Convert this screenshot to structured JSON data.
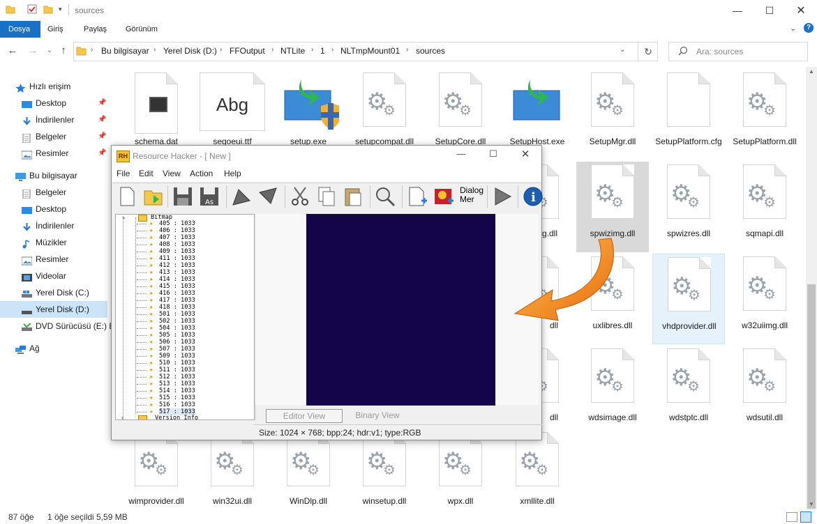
{
  "window": {
    "title": "sources"
  },
  "ribbon": {
    "tabs": [
      "Dosya",
      "Giriş",
      "Paylaş",
      "Görünüm"
    ]
  },
  "address": {
    "crumbs": [
      "Bu bilgisayar",
      "Yerel Disk (D:)",
      "FFOutput",
      "NTLite",
      "1",
      "NLTmpMount01",
      "sources"
    ],
    "search_placeholder": "Ara: sources"
  },
  "sidebar": {
    "items": [
      {
        "label": "Hızlı erişim",
        "icon": "star-icon"
      },
      {
        "label": "Desktop",
        "icon": "desktop-icon"
      },
      {
        "label": "İndirilenler",
        "icon": "download-icon"
      },
      {
        "label": "Belgeler",
        "icon": "documents-icon"
      },
      {
        "label": "Resimler",
        "icon": "pictures-icon"
      },
      {
        "label": "Bu bilgisayar",
        "icon": "computer-icon"
      },
      {
        "label": "Belgeler",
        "icon": "documents-icon"
      },
      {
        "label": "Desktop",
        "icon": "desktop-icon"
      },
      {
        "label": "İndirilenler",
        "icon": "download-icon"
      },
      {
        "label": "Müzikler",
        "icon": "music-icon"
      },
      {
        "label": "Resimler",
        "icon": "pictures-icon"
      },
      {
        "label": "Videolar",
        "icon": "video-icon"
      },
      {
        "label": "Yerel Disk (C:)",
        "icon": "drive-icon"
      },
      {
        "label": "Yerel Disk (D:)",
        "icon": "drive-icon"
      },
      {
        "label": "DVD Sürücüsü (E:) E",
        "icon": "dvd-icon"
      },
      {
        "label": "Ağ",
        "icon": "network-icon"
      }
    ]
  },
  "files": [
    "schema.dat",
    "segoeui.ttf",
    "setup.exe",
    "setupcompat.dll",
    "SetupCore.dll",
    "SetupHost.exe",
    "SetupMgr.dll",
    "SetupPlatform.cfg",
    "SetupPlatform.dll",
    "spwizimg.dll",
    "spwizres.dll",
    "sqmapi.dll",
    "uxlibres.dll",
    "vhdprovider.dll",
    "w32uiimg.dll",
    "wdsimage.dll",
    "wdstptc.dll",
    "wdsutil.dll",
    "wimprovider.dll",
    "win32ui.dll",
    "WinDlp.dll",
    "winsetup.dll",
    "wpx.dll",
    "xmllite.dll",
    "g.dll",
    "dll",
    "dll"
  ],
  "file_glyphs": {
    "font_sample": "Abg"
  },
  "rh": {
    "title": "Resource Hacker - [ New ]",
    "menu": [
      "File",
      "Edit",
      "View",
      "Action",
      "Help"
    ],
    "dialog_btn": "Dialog Mer",
    "tree_root": "Bitmap",
    "tree_items": [
      "405 : 1033",
      "406 : 1033",
      "407 : 1033",
      "408 : 1033",
      "409 : 1033",
      "411 : 1033",
      "412 : 1033",
      "413 : 1033",
      "414 : 1033",
      "415 : 1033",
      "416 : 1033",
      "417 : 1033",
      "418 : 1033",
      "501 : 1033",
      "502 : 1033",
      "504 : 1033",
      "505 : 1033",
      "506 : 1033",
      "507 : 1033",
      "509 : 1033",
      "510 : 1033",
      "511 : 1033",
      "512 : 1033",
      "513 : 1033",
      "514 : 1033",
      "515 : 1033",
      "516 : 1033",
      "517 : 1033"
    ],
    "tree_next": "Version Info",
    "editor_tab": "Editor View",
    "binary_tab": "Binary View",
    "status": "Size: 1024 × 768;  bpp:24;  hdr:v1;  type:RGB",
    "bitmap_color": "#14044a"
  },
  "status_bar": {
    "count": "87 öğe",
    "selection": "1 öğe seçildi  5,59 MB"
  },
  "accent": "#1a6fc7",
  "arrow_color": "#f08a1e"
}
